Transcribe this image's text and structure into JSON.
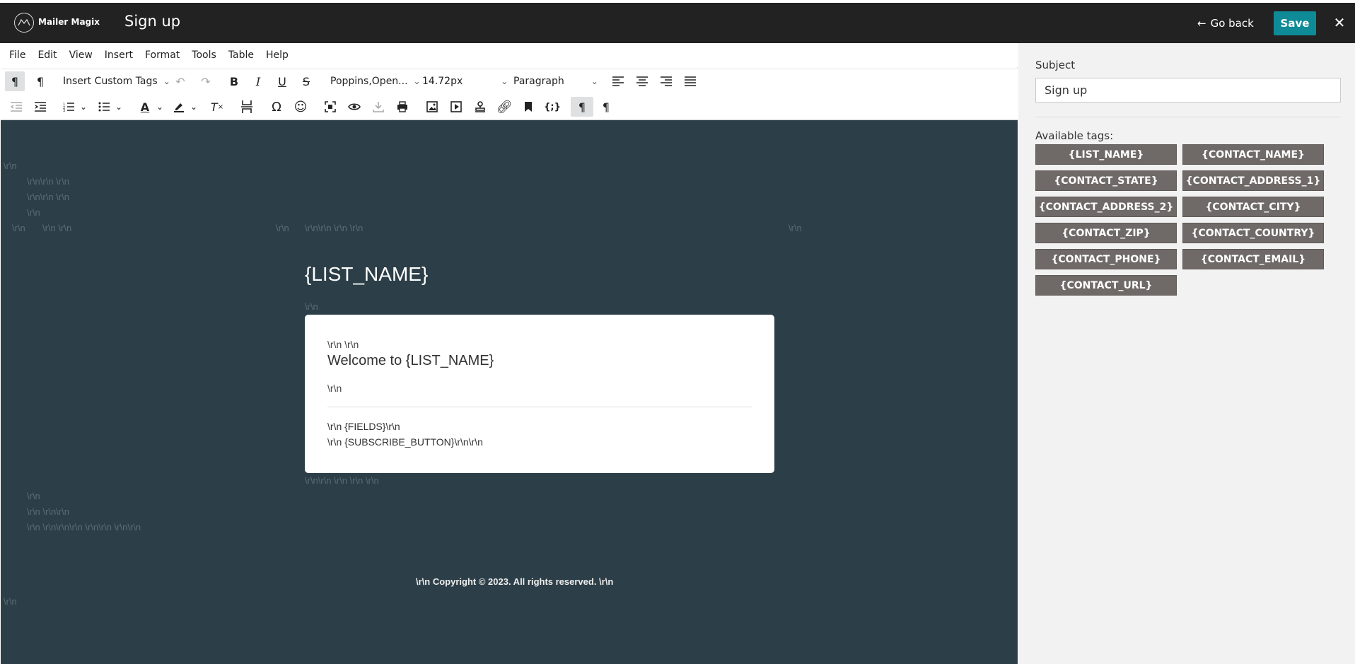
{
  "header": {
    "brand": "Mailer Magix",
    "title": "Sign up",
    "go_back": "Go back",
    "save": "Save",
    "close": "✕"
  },
  "menu": [
    "File",
    "Edit",
    "View",
    "Insert",
    "Format",
    "Tools",
    "Table",
    "Help"
  ],
  "toolbar": {
    "custom_tags": "Insert Custom Tags",
    "font_family": "Poppins,Open...",
    "font_size": "14.72px",
    "block_format": "Paragraph"
  },
  "canvas": {
    "lines": [
      "\\r\\n",
      "\\r\\n\\r\\n \\r\\n",
      "\\r\\n\\r\\n \\r\\n",
      "\\r\\n",
      "\\r\\n",
      "\\r\\n \\r\\n",
      "\\r\\n",
      "\\r\\n\\r\\n \\r\\n \\r\\n",
      "\\r\\n",
      "\\r\\n",
      "\\r\\n\\r\\n \\r\\n \\r\\n \\r\\n",
      "\\r\\n",
      "\\r\\n \\r\\n\\r\\n",
      "\\r\\n \\r\\n\\r\\n\\r\\n \\r\\n\\r\\n \\r\\n\\r\\n",
      "\\r\\n"
    ],
    "list_name": "{LIST_NAME}",
    "card": {
      "top": "\\r\\n \\r\\n",
      "welcome": "Welcome to {LIST_NAME}",
      "line": "\\r\\n",
      "fields": "\\r\\n {FIELDS}\\r\\n",
      "subscribe": "\\r\\n {SUBSCRIBE_BUTTON}\\r\\n\\r\\n"
    },
    "copyright": "\\r\\n Copyright © 2023. All rights reserved. \\r\\n"
  },
  "panel": {
    "subject_label": "Subject",
    "subject_value": "Sign up",
    "tags_label": "Available tags:",
    "tags": [
      "{LIST_NAME}",
      "{CONTACT_NAME}",
      "{CONTACT_STATE}",
      "{CONTACT_ADDRESS_1}",
      "{CONTACT_ADDRESS_2}",
      "{CONTACT_CITY}",
      "{CONTACT_ZIP}",
      "{CONTACT_COUNTRY}",
      "{CONTACT_PHONE}",
      "{CONTACT_EMAIL}",
      "{CONTACT_URL}"
    ]
  }
}
